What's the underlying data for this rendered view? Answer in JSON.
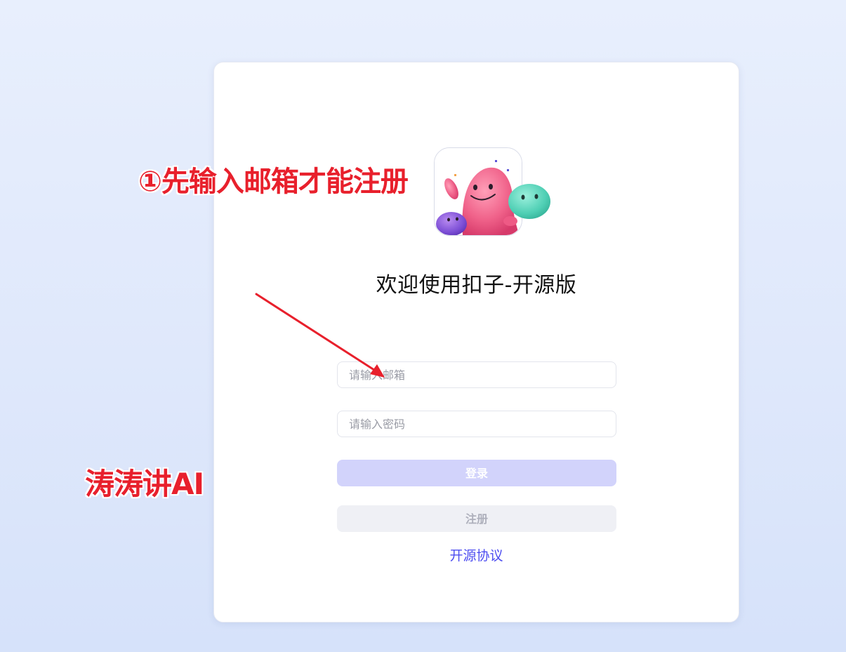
{
  "app": {
    "title": "欢迎使用扣子-开源版"
  },
  "form": {
    "email_placeholder": "请输入邮箱",
    "password_placeholder": "请输入密码",
    "login_label": "登录",
    "register_label": "注册",
    "license_link": "开源协议"
  },
  "annotations": {
    "note": "①先输入邮箱才能注册",
    "watermark": "涛涛讲AI"
  },
  "colors": {
    "accent": "#4d4df0",
    "login_button_disabled": "#d2d3fb",
    "register_button": "#eff0f5",
    "annotation": "#e8202c"
  },
  "icons": {
    "logo": "coze-mascot-logo"
  }
}
